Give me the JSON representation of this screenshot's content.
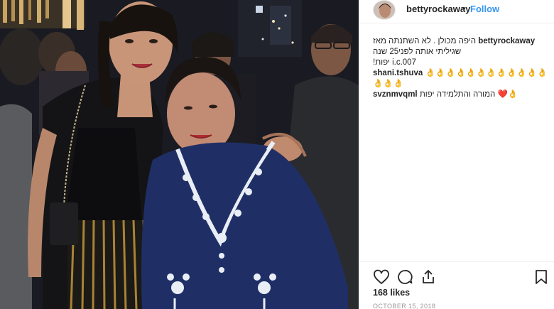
{
  "post": {
    "username": "bettyrockaway",
    "separator": "•",
    "follow_label": "Follow",
    "caption_user": "bettyrockaway",
    "caption_line1": "היפה מכולן . לא השתנתה מאז",
    "caption_line2": "שגיליתי אותה לפני25 שנה",
    "caption_line3": "i.c.007 יפות!",
    "comments": [
      {
        "user": "shani.tshuva",
        "text": "👌👌👌👌👌👌👌👌👌👌👌👌👌👌👌"
      },
      {
        "user": "svznmvqml",
        "text": "המורה והתלמידה יפות ❤️👌"
      }
    ],
    "likes": "168 likes",
    "date": "OCTOBER 15, 2018"
  },
  "icons": {
    "like": "heart-outline-icon",
    "comment": "speech-bubble-icon",
    "share": "share-arrow-icon",
    "save": "bookmark-icon"
  },
  "colors": {
    "follow": "#3897f0",
    "text": "#262626",
    "muted": "#999999",
    "photo_bg": "#17181d",
    "blouse_blue": "#1f2f66",
    "embroidery": "#e9eef6"
  }
}
